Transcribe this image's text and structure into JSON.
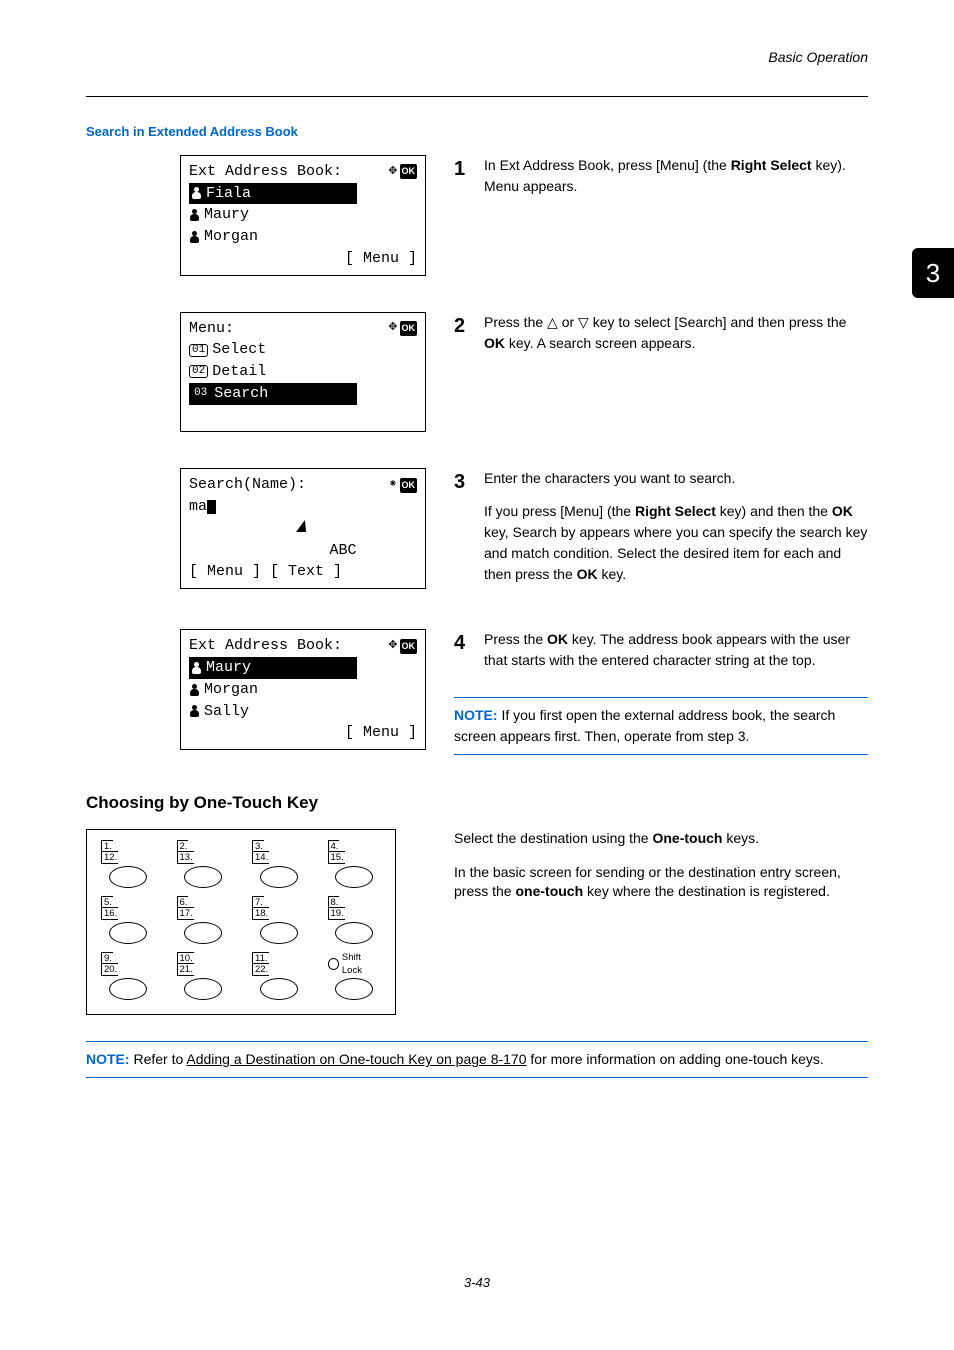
{
  "header": {
    "chapter": "Basic Operation"
  },
  "page_tab": "3",
  "section_title": "Search in Extended Address Book",
  "lcd1": {
    "title": "Ext Address Book:",
    "items": [
      "Fiala",
      "Maury",
      "Morgan"
    ],
    "softkey": "[  Menu  ]"
  },
  "lcd2": {
    "title": "Menu:",
    "items": [
      {
        "n": "01",
        "label": "Select"
      },
      {
        "n": "02",
        "label": "Detail"
      },
      {
        "n": "03",
        "label": "Search"
      }
    ]
  },
  "lcd3": {
    "title": "Search(Name):",
    "input": "ma",
    "mode": "ABC",
    "softkeys": "[  Menu  ] [  Text  ]"
  },
  "lcd4": {
    "title": "Ext Address Book:",
    "items": [
      "Maury",
      "Morgan",
      "Sally"
    ],
    "softkey": "[  Menu  ]"
  },
  "steps": {
    "s1": {
      "num": "1",
      "body_pre": "In Ext Address Book, press [Menu] (the ",
      "body_bold": "Right Select",
      "body_post": " key). Menu appears."
    },
    "s2": {
      "num": "2",
      "body_pre": "Press the ",
      "tri_up": "△",
      "mid1": " or ",
      "tri_dn": "▽",
      "mid2": " key to select [Search] and then press the ",
      "bold": "OK",
      "post": " key. A search screen appears."
    },
    "s3": {
      "num": "3",
      "p1": "Enter the characters you want to search.",
      "p2_pre": "If you press [Menu] (the ",
      "p2_b1": "Right Select",
      "p2_m1": " key) and then the ",
      "p2_b2": "OK",
      "p2_m2": " key, Search by appears where you can specify the search key and match condition. Select the desired item for each and then press the ",
      "p2_b3": "OK",
      "p2_post": " key."
    },
    "s4": {
      "num": "4",
      "pre": "Press the ",
      "bold": "OK",
      "post": " key. The address book appears with the user that starts with the entered character string at the top."
    }
  },
  "note1": {
    "label": "NOTE:",
    "text": " If you first open the external address book, the search screen appears first. Then, operate from step 3."
  },
  "subhead": "Choosing by One-Touch Key",
  "keypad": {
    "rows": [
      [
        [
          "1.",
          "12."
        ],
        [
          "2.",
          "13."
        ],
        [
          "3.",
          "14."
        ],
        [
          "4.",
          "15."
        ]
      ],
      [
        [
          "5.",
          "16."
        ],
        [
          "6.",
          "17."
        ],
        [
          "7.",
          "18."
        ],
        [
          "8.",
          "19."
        ]
      ],
      [
        [
          "9.",
          "20."
        ],
        [
          "10.",
          "21."
        ],
        [
          "11.",
          "22."
        ]
      ]
    ],
    "shift": "Shift Lock"
  },
  "onetouch": {
    "p1_pre": "Select the destination using the ",
    "p1_bold": "One-touch",
    "p1_post": " keys.",
    "p2_pre": "In the basic screen for sending or the destination entry screen, press the ",
    "p2_bold": "one-touch",
    "p2_post": " key where the destination is registered."
  },
  "note2": {
    "label": "NOTE:",
    "pre": " Refer to ",
    "link": "Adding a Destination on One-touch Key on page 8-170",
    "post": " for more information on adding one-touch keys."
  },
  "footer": "3-43"
}
